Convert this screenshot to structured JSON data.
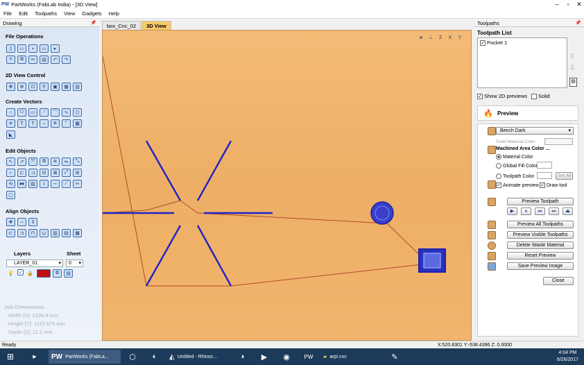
{
  "title": "PartWorks (FabLab India) - [3D View]",
  "logo": "PW",
  "menu": [
    "File",
    "Edit",
    "Toolpaths",
    "View",
    "Gadgets",
    "Help"
  ],
  "left": {
    "header": "Drawing",
    "file_ops": "File Operations",
    "view2d": "2D View Control",
    "create": "Create Vectors",
    "edit": "Edit Objects",
    "align": "Align Objects",
    "layers": "Layers",
    "sheet": "Sheet",
    "layer_value": "LAYER_01",
    "sheet_value": "0",
    "job": {
      "title": "Job Dimensions",
      "width": "Width  [X]: 1238.8 mm",
      "height": "Height [Y]: 1115.675 mm",
      "depth": "Depth  [Z]: 11.2 mm"
    }
  },
  "tabs": [
    "box_Cnc_02",
    "3D View"
  ],
  "right": {
    "header": "Toolpaths",
    "list_title": "Toolpath List",
    "item": "Pocket 1",
    "show2d": "Show 2D previews",
    "solid": "Solid",
    "preview": "Preview",
    "material": "Beech Dark",
    "solid_color": "Solid Material Color",
    "machined": "Machined Area Color ...",
    "mat_color": "Material Color",
    "global_fill": "Global Fill Color",
    "tp_color": "Toolpath Color",
    "set_all": "Set All",
    "animate": "Animate preview",
    "draw_tool": "Draw tool",
    "preview_tp": "Preview Toolpath",
    "preview_all": "Preview All Toolpaths",
    "preview_visible": "Preview Visible Toolpaths",
    "delete_waste": "Delete Waste Material",
    "reset": "Reset Preview",
    "save_image": "Save Preview Image",
    "close": "Close"
  },
  "status": {
    "left": "Ready",
    "coords": "X:520.8301 Y:-538.4396 Z: 0.0000"
  },
  "taskbar": {
    "pw": "PartWorks (FabLa...",
    "rhino": "Untitled - Rhinoc...",
    "folder": "arpi cnc",
    "time": "4:04 PM",
    "date": "6/26/2017"
  }
}
